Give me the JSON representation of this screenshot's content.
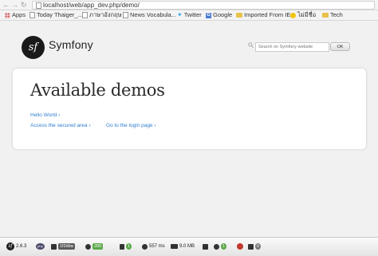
{
  "browser": {
    "url": "localhost/web/app_dev.php/demo/",
    "bookmarks": [
      "Apps",
      "Today Thaiger_...",
      "ภาษาอังกฤษ",
      "News Vocabula...",
      "Twitter",
      "Google",
      "Imported From IE",
      "ไม่มีชื่อ",
      "Tech"
    ]
  },
  "header": {
    "logo_text": "Symfony",
    "logo_mark": "sf",
    "search_placeholder": "Search on Symfony website",
    "ok_label": "OK"
  },
  "main": {
    "title": "Available demos",
    "links": [
      {
        "label": "Hello World ›"
      },
      {
        "label": "Access the secured area ›"
      },
      {
        "label": "Go to the login page ›"
      }
    ]
  },
  "toolbar": {
    "version": "2.6.3",
    "php": "php",
    "token": "1f2dba",
    "status": "200",
    "route_count": "1",
    "time": "557 ms",
    "memory": "9.0 MB",
    "counters": [
      "1",
      "0"
    ],
    "icons": [
      "symfony-logo-icon",
      "php-icon",
      "config-icon",
      "request-icon",
      "route-icon",
      "timer-icon",
      "memory-icon",
      "form-icon",
      "logger-icon",
      "security-icon",
      "twig-icon",
      "doctrine-icon"
    ]
  },
  "colors": {
    "link": "#2f7fd0",
    "status_ok": "#5aa94a",
    "token_bg": "#5a5a5a"
  }
}
